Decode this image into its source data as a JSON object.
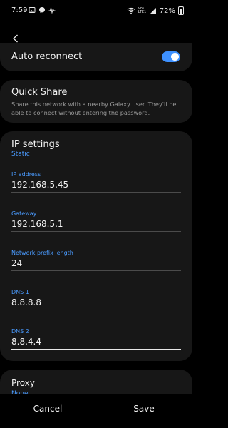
{
  "status_bar": {
    "time": "7:59",
    "battery": "72%",
    "network_badge": "Vo) LTE1"
  },
  "auto_reconnect": {
    "label": "Auto reconnect",
    "enabled": true,
    "toggle_color": "#3e91ff"
  },
  "quick_share": {
    "title": "Quick Share",
    "description": "Share this network with a nearby Galaxy user. They'll be able to connect without entering the password."
  },
  "ip_settings": {
    "title": "IP settings",
    "value": "Static",
    "fields": [
      {
        "label": "IP address",
        "value": "192.168.5.45"
      },
      {
        "label": "Gateway",
        "value": "192.168.5.1"
      },
      {
        "label": "Network prefix length",
        "value": "24"
      },
      {
        "label": "DNS 1",
        "value": "8.8.8.8"
      },
      {
        "label": "DNS 2",
        "value": "8.8.4.4"
      }
    ]
  },
  "proxy": {
    "title": "Proxy",
    "value": "None"
  },
  "actions": {
    "cancel": "Cancel",
    "save": "Save"
  },
  "colors": {
    "accent": "#4a9bff",
    "card_background": "#171717",
    "background": "#000000"
  }
}
